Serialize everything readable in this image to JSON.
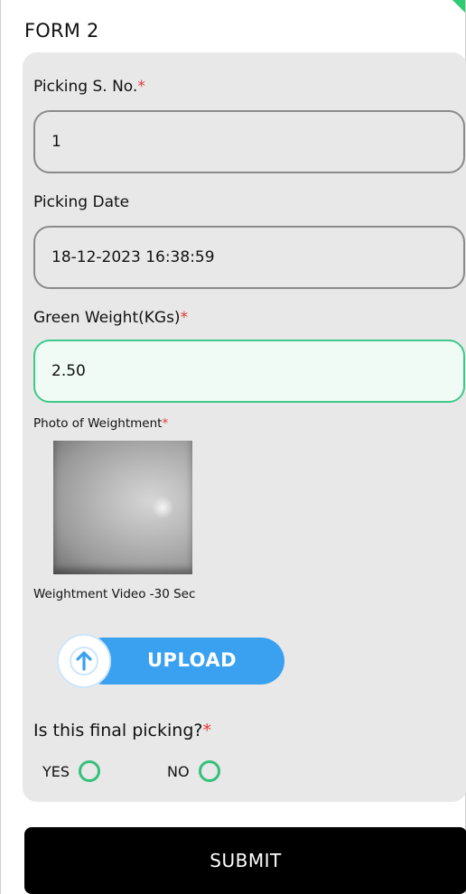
{
  "form": {
    "title": "FORM 2"
  },
  "fields": {
    "picking_sno": {
      "label": "Picking S. No.",
      "required_mark": "*",
      "value": "1"
    },
    "picking_date": {
      "label": "Picking Date",
      "value": "18-12-2023 16:38:59"
    },
    "green_weight": {
      "label": "Green Weight(KGs)",
      "required_mark": "*",
      "value": "2.50"
    }
  },
  "photo": {
    "label": "Photo of Weightment",
    "required_mark": "*"
  },
  "video": {
    "label": "Weightment Video -30 Sec"
  },
  "upload": {
    "label": "UPLOAD",
    "icon": "arrow-up-icon"
  },
  "final_picking": {
    "question": "Is this final picking?",
    "required_mark": "*",
    "options": [
      {
        "label": "YES"
      },
      {
        "label": "NO"
      }
    ]
  },
  "submit": {
    "label": "SUBMIT"
  },
  "colors": {
    "accent_green": "#3cc98a",
    "upload_blue": "#3aa0f0",
    "required_red": "#e53935",
    "card_gray": "#e8e8e8"
  }
}
